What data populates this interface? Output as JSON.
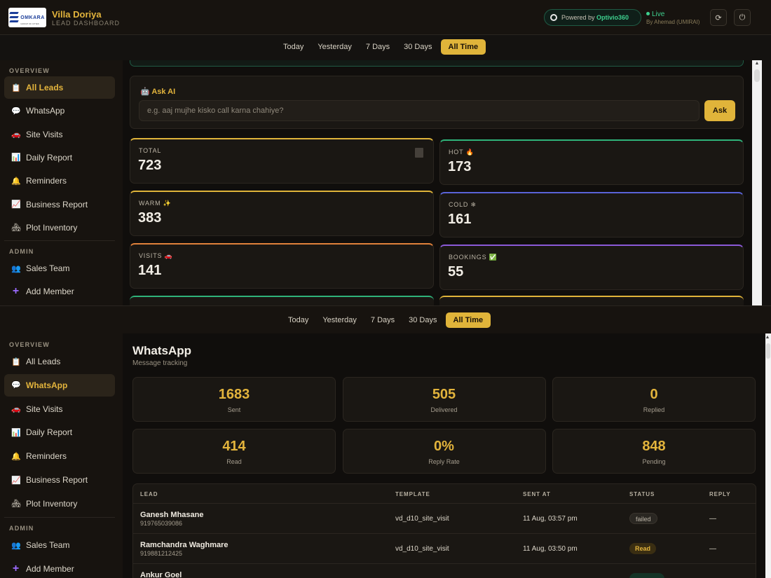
{
  "header": {
    "brand_title": "Villa Doriya",
    "brand_sub": "LEAD DASHBOARD",
    "logo_text": "OMKARA",
    "logo_sub": "GROUP OF CITIES",
    "powered_prefix": "Powered by",
    "powered_brand": "Optivio360",
    "live_label": "Live",
    "by_label": "By Ahemad (UMIRAI)",
    "refresh_icon": "⟳",
    "power_icon": "⏻"
  },
  "filters": [
    "Today",
    "Yesterday",
    "7 Days",
    "30 Days",
    "All Time"
  ],
  "filters_active": "All Time",
  "sidebar": {
    "overview_label": "OVERVIEW",
    "admin_label": "ADMIN",
    "items": [
      {
        "label": "All Leads",
        "icon": "📋"
      },
      {
        "label": "WhatsApp",
        "icon": "💬"
      },
      {
        "label": "Site Visits",
        "icon": "🚗"
      },
      {
        "label": "Daily Report",
        "icon": "📊"
      },
      {
        "label": "Reminders",
        "icon": "🔔"
      },
      {
        "label": "Business Report",
        "icon": "📈"
      },
      {
        "label": "Plot Inventory",
        "icon": "🏘"
      }
    ],
    "admin_items": [
      {
        "label": "Sales Team",
        "icon": "👥"
      },
      {
        "label": "Add Member",
        "icon": "+"
      }
    ]
  },
  "ask_ai": {
    "title": "🤖 Ask AI",
    "placeholder": "e.g. aaj mujhe kisko call karna chahiye?",
    "button": "Ask"
  },
  "stats": [
    {
      "label": "TOTAL",
      "value": "723",
      "accent": "#e0b43a"
    },
    {
      "label": "HOT 🔥",
      "value": "173",
      "accent": "#2fb37a"
    },
    {
      "label": "WARM ✨",
      "value": "383",
      "accent": "#e0b43a"
    },
    {
      "label": "COLD ❄",
      "value": "161",
      "accent": "#5a63d8"
    },
    {
      "label": "VISITS 🚗",
      "value": "141",
      "accent": "#e0813a"
    },
    {
      "label": "BOOKINGS ✅",
      "value": "55",
      "accent": "#8b5ad8"
    }
  ],
  "whatsapp": {
    "title": "WhatsApp",
    "subtitle": "Message tracking",
    "cards": [
      {
        "value": "1683",
        "label": "Sent"
      },
      {
        "value": "505",
        "label": "Delivered"
      },
      {
        "value": "0",
        "label": "Replied"
      },
      {
        "value": "414",
        "label": "Read"
      },
      {
        "value": "0%",
        "label": "Reply Rate"
      },
      {
        "value": "848",
        "label": "Pending"
      }
    ],
    "columns": [
      "LEAD",
      "TEMPLATE",
      "SENT AT",
      "STATUS",
      "REPLY"
    ],
    "rows": [
      {
        "name": "Ganesh Mhasane",
        "phone": "919765039086",
        "template": "vd_d10_site_visit",
        "sent_at": "11 Aug, 03:57 pm",
        "status": "failed",
        "reply": "—"
      },
      {
        "name": "Ramchandra Waghmare",
        "phone": "919881212425",
        "template": "vd_d10_site_visit",
        "sent_at": "11 Aug, 03:50 pm",
        "status": "Read",
        "reply": "—"
      },
      {
        "name": "Ankur Goel",
        "phone": "",
        "template": "",
        "sent_at": "",
        "status": "",
        "reply": ""
      }
    ]
  },
  "colors": {
    "accent": "#e0b43a",
    "live": "#3ed08f",
    "bg": "#100e0c"
  }
}
